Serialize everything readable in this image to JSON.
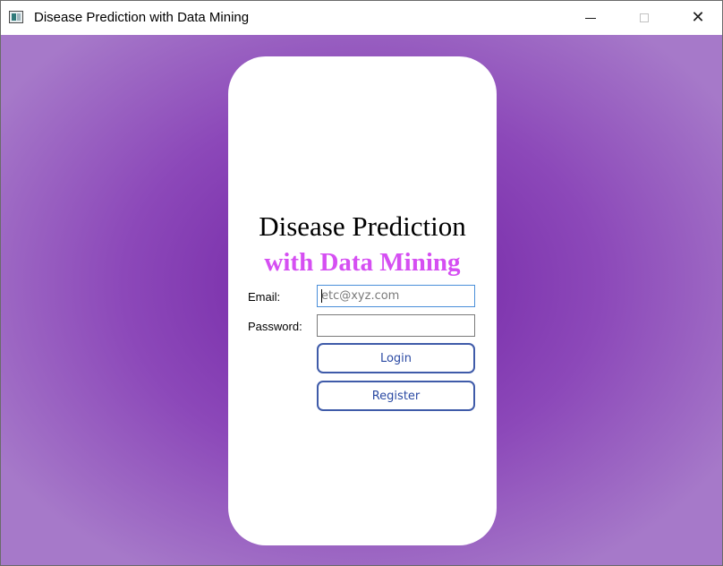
{
  "window": {
    "title": "Disease Prediction with Data Mining",
    "icon": "app-window-icon",
    "controls": {
      "minimize_icon": "minimize-icon",
      "maximize_icon": "maximize-icon",
      "close_symbol": "✕"
    }
  },
  "login_card": {
    "heading_line1": "Disease Prediction",
    "heading_line2": "with Data Mining",
    "email": {
      "label": "Email:",
      "value": "",
      "placeholder": "etc@xyz.com"
    },
    "password": {
      "label": "Password:",
      "value": "",
      "placeholder": ""
    },
    "login_label": "Login",
    "register_label": "Register"
  },
  "colors": {
    "background_center": "#7021a3",
    "background_edge": "#a679c9",
    "card": "#ffffff",
    "heading_accent": "#d54ff2",
    "button_border": "#3f5ba9",
    "focus_border": "#4a8fd9"
  }
}
